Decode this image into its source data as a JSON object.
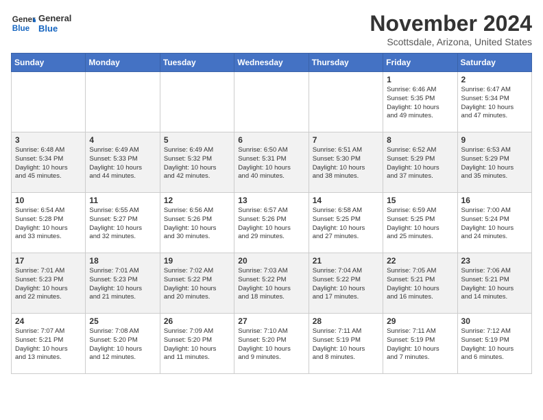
{
  "header": {
    "logo_line1": "General",
    "logo_line2": "Blue",
    "month": "November 2024",
    "location": "Scottsdale, Arizona, United States"
  },
  "weekdays": [
    "Sunday",
    "Monday",
    "Tuesday",
    "Wednesday",
    "Thursday",
    "Friday",
    "Saturday"
  ],
  "weeks": [
    [
      {
        "day": "",
        "info": ""
      },
      {
        "day": "",
        "info": ""
      },
      {
        "day": "",
        "info": ""
      },
      {
        "day": "",
        "info": ""
      },
      {
        "day": "",
        "info": ""
      },
      {
        "day": "1",
        "info": "Sunrise: 6:46 AM\nSunset: 5:35 PM\nDaylight: 10 hours\nand 49 minutes."
      },
      {
        "day": "2",
        "info": "Sunrise: 6:47 AM\nSunset: 5:34 PM\nDaylight: 10 hours\nand 47 minutes."
      }
    ],
    [
      {
        "day": "3",
        "info": "Sunrise: 6:48 AM\nSunset: 5:34 PM\nDaylight: 10 hours\nand 45 minutes."
      },
      {
        "day": "4",
        "info": "Sunrise: 6:49 AM\nSunset: 5:33 PM\nDaylight: 10 hours\nand 44 minutes."
      },
      {
        "day": "5",
        "info": "Sunrise: 6:49 AM\nSunset: 5:32 PM\nDaylight: 10 hours\nand 42 minutes."
      },
      {
        "day": "6",
        "info": "Sunrise: 6:50 AM\nSunset: 5:31 PM\nDaylight: 10 hours\nand 40 minutes."
      },
      {
        "day": "7",
        "info": "Sunrise: 6:51 AM\nSunset: 5:30 PM\nDaylight: 10 hours\nand 38 minutes."
      },
      {
        "day": "8",
        "info": "Sunrise: 6:52 AM\nSunset: 5:29 PM\nDaylight: 10 hours\nand 37 minutes."
      },
      {
        "day": "9",
        "info": "Sunrise: 6:53 AM\nSunset: 5:29 PM\nDaylight: 10 hours\nand 35 minutes."
      }
    ],
    [
      {
        "day": "10",
        "info": "Sunrise: 6:54 AM\nSunset: 5:28 PM\nDaylight: 10 hours\nand 33 minutes."
      },
      {
        "day": "11",
        "info": "Sunrise: 6:55 AM\nSunset: 5:27 PM\nDaylight: 10 hours\nand 32 minutes."
      },
      {
        "day": "12",
        "info": "Sunrise: 6:56 AM\nSunset: 5:26 PM\nDaylight: 10 hours\nand 30 minutes."
      },
      {
        "day": "13",
        "info": "Sunrise: 6:57 AM\nSunset: 5:26 PM\nDaylight: 10 hours\nand 29 minutes."
      },
      {
        "day": "14",
        "info": "Sunrise: 6:58 AM\nSunset: 5:25 PM\nDaylight: 10 hours\nand 27 minutes."
      },
      {
        "day": "15",
        "info": "Sunrise: 6:59 AM\nSunset: 5:25 PM\nDaylight: 10 hours\nand 25 minutes."
      },
      {
        "day": "16",
        "info": "Sunrise: 7:00 AM\nSunset: 5:24 PM\nDaylight: 10 hours\nand 24 minutes."
      }
    ],
    [
      {
        "day": "17",
        "info": "Sunrise: 7:01 AM\nSunset: 5:23 PM\nDaylight: 10 hours\nand 22 minutes."
      },
      {
        "day": "18",
        "info": "Sunrise: 7:01 AM\nSunset: 5:23 PM\nDaylight: 10 hours\nand 21 minutes."
      },
      {
        "day": "19",
        "info": "Sunrise: 7:02 AM\nSunset: 5:22 PM\nDaylight: 10 hours\nand 20 minutes."
      },
      {
        "day": "20",
        "info": "Sunrise: 7:03 AM\nSunset: 5:22 PM\nDaylight: 10 hours\nand 18 minutes."
      },
      {
        "day": "21",
        "info": "Sunrise: 7:04 AM\nSunset: 5:22 PM\nDaylight: 10 hours\nand 17 minutes."
      },
      {
        "day": "22",
        "info": "Sunrise: 7:05 AM\nSunset: 5:21 PM\nDaylight: 10 hours\nand 16 minutes."
      },
      {
        "day": "23",
        "info": "Sunrise: 7:06 AM\nSunset: 5:21 PM\nDaylight: 10 hours\nand 14 minutes."
      }
    ],
    [
      {
        "day": "24",
        "info": "Sunrise: 7:07 AM\nSunset: 5:21 PM\nDaylight: 10 hours\nand 13 minutes."
      },
      {
        "day": "25",
        "info": "Sunrise: 7:08 AM\nSunset: 5:20 PM\nDaylight: 10 hours\nand 12 minutes."
      },
      {
        "day": "26",
        "info": "Sunrise: 7:09 AM\nSunset: 5:20 PM\nDaylight: 10 hours\nand 11 minutes."
      },
      {
        "day": "27",
        "info": "Sunrise: 7:10 AM\nSunset: 5:20 PM\nDaylight: 10 hours\nand 9 minutes."
      },
      {
        "day": "28",
        "info": "Sunrise: 7:11 AM\nSunset: 5:19 PM\nDaylight: 10 hours\nand 8 minutes."
      },
      {
        "day": "29",
        "info": "Sunrise: 7:11 AM\nSunset: 5:19 PM\nDaylight: 10 hours\nand 7 minutes."
      },
      {
        "day": "30",
        "info": "Sunrise: 7:12 AM\nSunset: 5:19 PM\nDaylight: 10 hours\nand 6 minutes."
      }
    ]
  ]
}
